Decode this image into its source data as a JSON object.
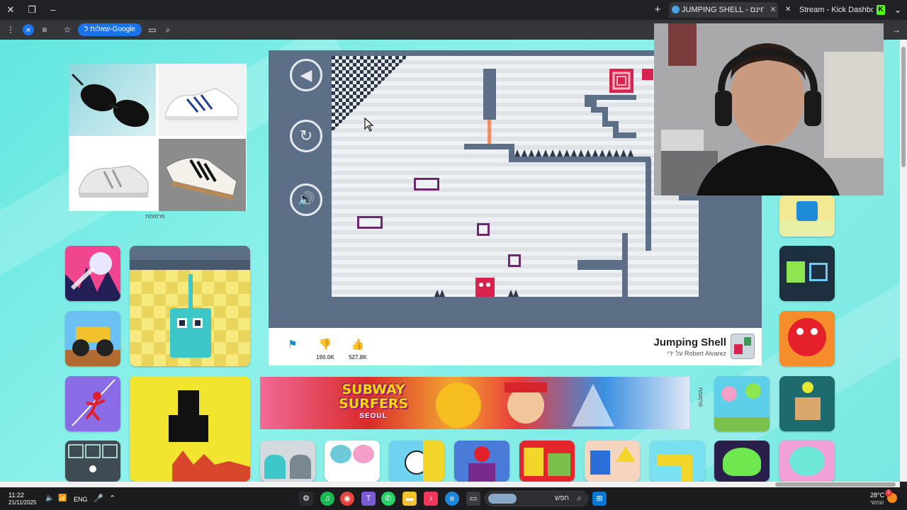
{
  "browser": {
    "tabs": [
      {
        "title": "JUMPING SHELL - משחק מקוון בחינם",
        "active": true
      },
      {
        "title": "Stream - Kick Dashboard",
        "active": false
      }
    ],
    "google_chip": "שאלות ל-Google",
    "profile_initial": "א"
  },
  "page": {
    "ad_label": "פרסומת",
    "ad_label_2": "פרסומת",
    "game": {
      "title": "Jumping Shell",
      "author": "על ידי Robert Alvarez",
      "dislikes": "190.0K",
      "likes": "527.8K",
      "controls": {
        "back": "◀",
        "restart": "↻",
        "sound": "🔊"
      }
    },
    "banner": {
      "title": "SUBWAY SURFERS",
      "subtitle": "SEOUL"
    }
  },
  "taskbar": {
    "time": "11:22",
    "date": "21/11/2025",
    "language": "ENG",
    "search_placeholder": "חפש",
    "weather_temp": "28°C",
    "weather_desc": "שמשי",
    "notification_count": "1"
  },
  "colors": {
    "page_bg": "#7ae8e2",
    "game_bg": "#5c6f86",
    "block_outline": "#6b2a6e",
    "player": "#d9234f",
    "accent_blue": "#1a8fc9"
  }
}
